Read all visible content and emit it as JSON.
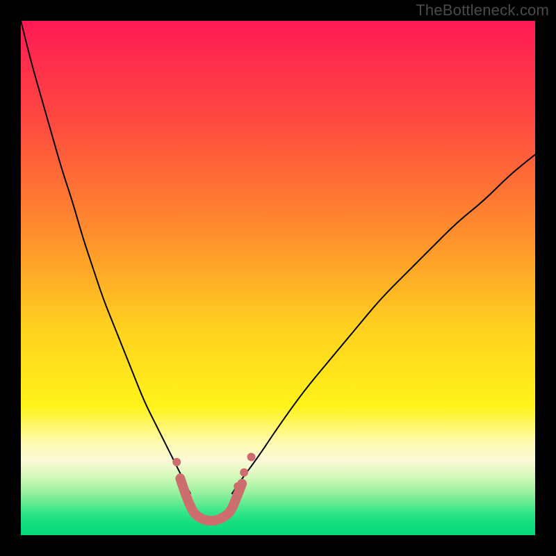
{
  "watermark": "TheBottleneck.com",
  "chart_data": {
    "type": "line",
    "title": "",
    "xlabel": "",
    "ylabel": "",
    "xlim": [
      0,
      100
    ],
    "ylim": [
      0,
      100
    ],
    "grid": false,
    "legend": false,
    "background_gradient_stops": [
      {
        "pct": 0.0,
        "color": "#ff1a55"
      },
      {
        "pct": 0.2,
        "color": "#ff4b3f"
      },
      {
        "pct": 0.4,
        "color": "#ff8a2e"
      },
      {
        "pct": 0.6,
        "color": "#ffd21f"
      },
      {
        "pct": 0.75,
        "color": "#fff31a"
      },
      {
        "pct": 0.82,
        "color": "#fffbb0"
      },
      {
        "pct": 0.855,
        "color": "#fbfad8"
      },
      {
        "pct": 0.875,
        "color": "#e4f9c3"
      },
      {
        "pct": 0.895,
        "color": "#c3f7b1"
      },
      {
        "pct": 0.915,
        "color": "#9df2a0"
      },
      {
        "pct": 0.935,
        "color": "#6aeb92"
      },
      {
        "pct": 0.955,
        "color": "#35e588"
      },
      {
        "pct": 0.975,
        "color": "#16de80"
      },
      {
        "pct": 1.0,
        "color": "#06d879"
      }
    ],
    "series": [
      {
        "name": "left-curve",
        "stroke": "#000000",
        "stroke_width": 2,
        "x": [
          0,
          2,
          4,
          6,
          8,
          10,
          12,
          14,
          16,
          18,
          20,
          22,
          24,
          26,
          28,
          30,
          31,
          32,
          33
        ],
        "y": [
          100,
          92,
          85,
          78,
          71,
          65,
          58,
          52,
          46,
          41,
          36,
          31,
          26,
          22,
          18,
          14,
          12,
          10,
          8
        ]
      },
      {
        "name": "right-curve",
        "stroke": "#000000",
        "stroke_width": 2,
        "x": [
          41,
          43,
          46,
          50,
          55,
          60,
          65,
          70,
          75,
          80,
          85,
          90,
          95,
          100
        ],
        "y": [
          8,
          11,
          15,
          21,
          28,
          34,
          40,
          46,
          51,
          56,
          61,
          65,
          70,
          74
        ]
      },
      {
        "name": "valley-sausage",
        "stroke": "#cc6e6e",
        "stroke_width": 14,
        "linecap": "round",
        "x": [
          31,
          32,
          33,
          34,
          36,
          38,
          40,
          41,
          42,
          43
        ],
        "y": [
          11,
          8,
          5.5,
          3.8,
          2.8,
          2.8,
          3.8,
          5,
          7.5,
          10
        ]
      }
    ],
    "markers": [
      {
        "x": 30.3,
        "y": 14.2,
        "r": 6,
        "fill": "#cc6e6e"
      },
      {
        "x": 31.0,
        "y": 11.2,
        "r": 6,
        "fill": "#cc6e6e"
      },
      {
        "x": 42.2,
        "y": 9.5,
        "r": 6,
        "fill": "#cc6e6e"
      },
      {
        "x": 43.4,
        "y": 12.2,
        "r": 6,
        "fill": "#cc6e6e"
      },
      {
        "x": 44.8,
        "y": 15.2,
        "r": 6,
        "fill": "#cc6e6e"
      }
    ]
  }
}
